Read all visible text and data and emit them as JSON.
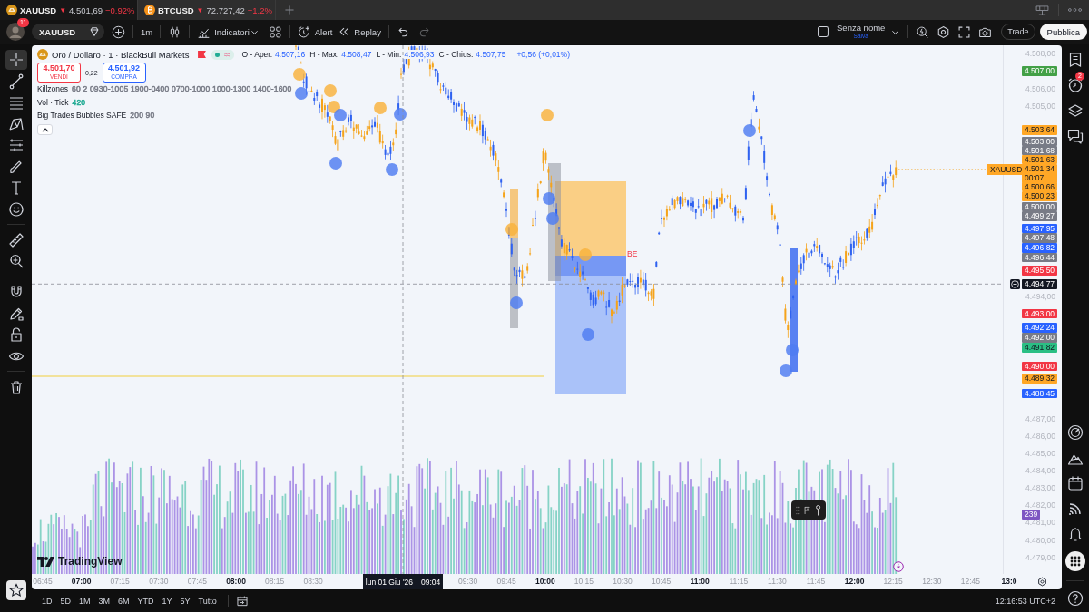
{
  "tabs": [
    {
      "kind": "gold",
      "symbol": "XAUUSD",
      "arrow": "▼",
      "price": "4.501,69",
      "change": "−0.92%",
      "selected": true
    },
    {
      "kind": "bitcoin",
      "symbol": "BTCUSD",
      "arrow": "▼",
      "price": "72.727,42",
      "change": "−1.2%",
      "selected": false
    }
  ],
  "toolbar": {
    "avatar_badge": "11",
    "symbol": "XAUUSD",
    "interval": "1m",
    "indicators": "Indicatori",
    "alert": "Alert",
    "replay": "Replay",
    "redo_disabled": true,
    "layout_name": "Senza nome",
    "layout_status": "Salva",
    "trade": "Trade",
    "publish": "Pubblica"
  },
  "drawing_tools": [
    {
      "kind": "crosshair",
      "selected": true
    },
    {
      "kind": "trend-line",
      "selected": false
    },
    {
      "kind": "horizontal-lines",
      "selected": false
    },
    {
      "kind": "pattern",
      "selected": false
    },
    {
      "kind": "fib",
      "selected": false
    },
    {
      "kind": "brush",
      "selected": false
    },
    {
      "kind": "text",
      "selected": false
    },
    {
      "kind": "emoji",
      "selected": false
    },
    {
      "kind": "ruler",
      "selected": false
    },
    {
      "kind": "zoom",
      "selected": false
    },
    {
      "kind": "magnet",
      "selected": false
    },
    {
      "kind": "lock-drawing",
      "selected": false
    },
    {
      "kind": "lock",
      "selected": false
    },
    {
      "kind": "eye",
      "selected": false
    },
    {
      "kind": "trash",
      "selected": false
    }
  ],
  "legend": {
    "title": "Oro / Dollaro · 1 · BlackBull Markets",
    "ohlc": [
      {
        "label": "O - Aper.",
        "value": "4.507,16"
      },
      {
        "label": "H - Max.",
        "value": "4.508,47"
      },
      {
        "label": "L - Min.",
        "value": "4.506,93"
      },
      {
        "label": "C - Chius.",
        "value": "4.507,75"
      }
    ],
    "change": "+0,56 (+0,01%)",
    "sell": {
      "price": "4.501,70",
      "label": "VENDI"
    },
    "spread": "0,22",
    "buy": {
      "price": "4.501,92",
      "label": "COMPRA"
    },
    "indicators": [
      {
        "name": "Killzones",
        "args": "60 2 0930-1005 1900-0400 0700-1000 1000-1300 1400-1600",
        "color": "#787b86"
      },
      {
        "name": "Vol · Tick",
        "args": "420",
        "color": "#22ab94"
      },
      {
        "name": "Big Trades Bubbles SAFE",
        "args": "200 90",
        "color": "#787b86"
      }
    ]
  },
  "chart": {
    "zone_label": "BE",
    "logo": "TradingView",
    "symbol_tag": "XAUUSD"
  },
  "price_axis": {
    "ticks": [
      "4.508,00",
      "4.506,00",
      "4.505,00",
      "4.494,00",
      "4.487,00",
      "4.486,00",
      "4.485,00",
      "4.484,00",
      "4.483,00",
      "4.482,00",
      "4.481,00",
      "4.480,00",
      "4.479,00"
    ],
    "tags": [
      {
        "text": "4.507,00",
        "color": "#43a047"
      },
      {
        "text": "4.503,64",
        "color": "#ffa726"
      },
      {
        "text": "4.503,00",
        "color": "#787b86"
      },
      {
        "text": "4.501,68",
        "color": "#787b86"
      },
      {
        "text": "4.501,63",
        "color": "#ffa726"
      },
      {
        "text": "4.501,34",
        "color": "#ffa726",
        "countdown": "00:07"
      },
      {
        "text": "4.500,66",
        "color": "#ffa726"
      },
      {
        "text": "4.500,23",
        "color": "#ffa726"
      },
      {
        "text": "4.500,00",
        "color": "#787b86"
      },
      {
        "text": "4.499,27",
        "color": "#787b86"
      },
      {
        "text": "4.497,95",
        "color": "#2962ff"
      },
      {
        "text": "4.497,48",
        "color": "#787b86"
      },
      {
        "text": "4.496,82",
        "color": "#2962ff"
      },
      {
        "text": "4.496,44",
        "color": "#787b86"
      },
      {
        "text": "4.495,50",
        "color": "#f23645"
      },
      {
        "text": "4.493,00",
        "color": "#f23645"
      },
      {
        "text": "4.492,24",
        "color": "#2962ff"
      },
      {
        "text": "4.492,00",
        "color": "#787b86"
      },
      {
        "text": "4.491,82",
        "color": "#2bbf84"
      },
      {
        "text": "4.490,00",
        "color": "#f23645"
      },
      {
        "text": "4.489,32",
        "color": "#ffa726"
      },
      {
        "text": "4.488,45",
        "color": "#2962ff"
      },
      {
        "text": "239",
        "color": "#7e57c2"
      }
    ]
  },
  "crosshair": {
    "price": "4.494,77",
    "date": "lun 01 Giu '26",
    "time": "09:04"
  },
  "time_axis": [
    {
      "text": "06:45",
      "bold": false
    },
    {
      "text": "07:00",
      "bold": true
    },
    {
      "text": "07:15",
      "bold": false
    },
    {
      "text": "07:30",
      "bold": false
    },
    {
      "text": "07:45",
      "bold": false
    },
    {
      "text": "08:00",
      "bold": true
    },
    {
      "text": "08:15",
      "bold": false
    },
    {
      "text": "08:30",
      "bold": false
    },
    {
      "text": "09:30",
      "bold": false
    },
    {
      "text": "09:45",
      "bold": false
    },
    {
      "text": "10:00",
      "bold": true
    },
    {
      "text": "10:15",
      "bold": false
    },
    {
      "text": "10:30",
      "bold": false
    },
    {
      "text": "10:45",
      "bold": false
    },
    {
      "text": "11:00",
      "bold": true
    },
    {
      "text": "11:15",
      "bold": false
    },
    {
      "text": "11:30",
      "bold": false
    },
    {
      "text": "11:45",
      "bold": false
    },
    {
      "text": "12:00",
      "bold": true
    },
    {
      "text": "12:15",
      "bold": false
    },
    {
      "text": "12:30",
      "bold": false
    },
    {
      "text": "12:45",
      "bold": false
    },
    {
      "text": "13:0",
      "bold": true
    }
  ],
  "right_sidebar": {
    "alerts_badge": "2"
  },
  "ranges": [
    "1D",
    "5D",
    "1M",
    "3M",
    "6M",
    "YTD",
    "1Y",
    "5Y",
    "Tutto"
  ],
  "clock": "12:16:53 UTC+2"
}
